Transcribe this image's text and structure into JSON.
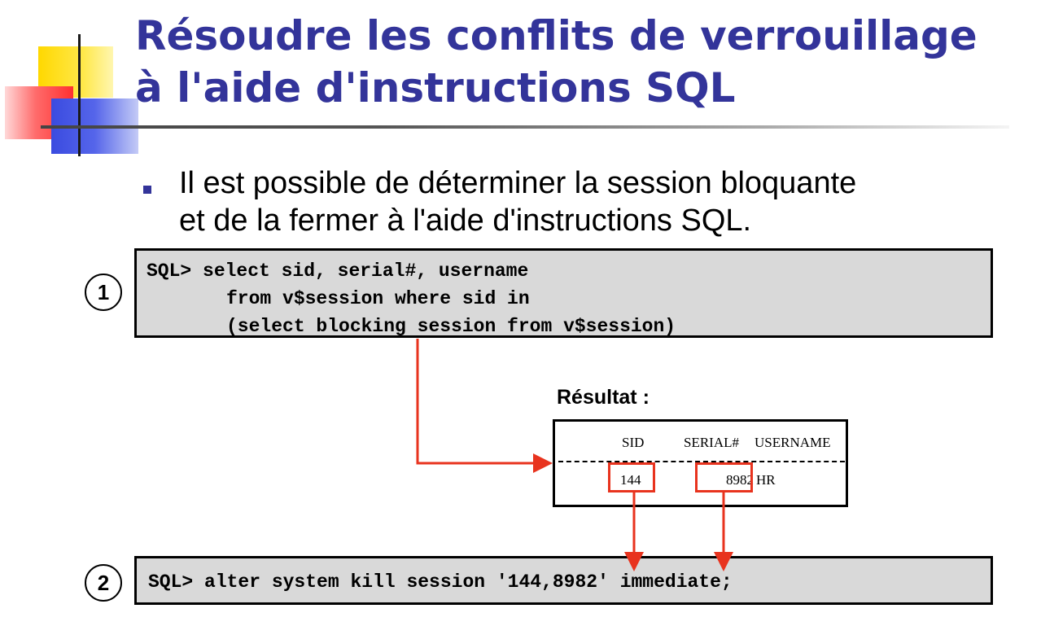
{
  "slide": {
    "title_lines": [
      "Résoudre les conflits de verrouillage",
      "à l'aide d'instructions SQL"
    ],
    "bullet_lines": [
      "Il est possible de déterminer la session bloquante",
      "et de la fermer à l'aide d'instructions SQL."
    ]
  },
  "step1": {
    "number": "1",
    "code_lines": [
      "SQL> select sid, serial#, username",
      "from v$session where sid in",
      "(select blocking session from v$session)"
    ]
  },
  "result": {
    "label": "Résultat :",
    "headers": [
      "SID",
      "SERIAL#",
      "USERNAME"
    ],
    "row": [
      "144",
      "8982",
      "HR"
    ]
  },
  "step2": {
    "number": "2",
    "code_line": "SQL> alter system kill session '144,8982' immediate;"
  },
  "colors": {
    "title": "#33349a",
    "highlight": "#e8331e",
    "code_background": "#d9d9d9"
  }
}
